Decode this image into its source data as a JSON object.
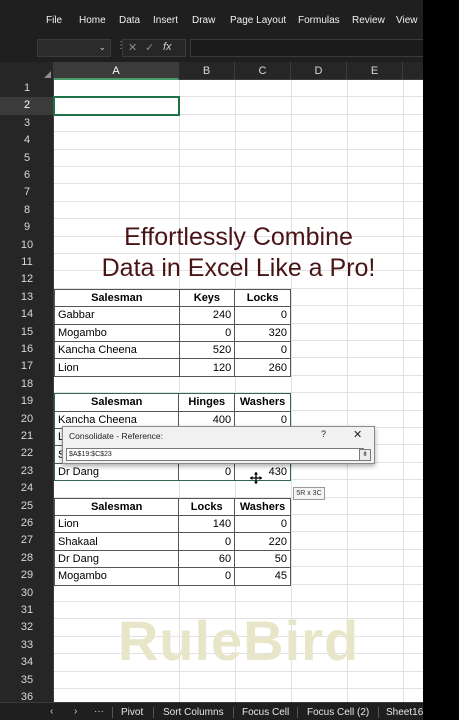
{
  "ribbon": {
    "tabs": [
      "File",
      "Home",
      "Data",
      "Insert",
      "Draw",
      "Page Layout",
      "Formulas",
      "Review",
      "View"
    ]
  },
  "formula_bar": {
    "name_box": "",
    "fx_label": "fx",
    "formula": ""
  },
  "columns": [
    "A",
    "B",
    "C",
    "D",
    "E"
  ],
  "rows": [
    "1",
    "2",
    "3",
    "4",
    "5",
    "6",
    "7",
    "8",
    "9",
    "10",
    "11",
    "12",
    "13",
    "14",
    "15",
    "16",
    "17",
    "18",
    "19",
    "20",
    "21",
    "22",
    "23",
    "24",
    "25",
    "26",
    "27",
    "28",
    "29",
    "30",
    "31",
    "32",
    "33",
    "34",
    "35",
    "36"
  ],
  "headline": {
    "line1": "Effortlessly Combine",
    "line2": "Data in Excel Like a Pro!"
  },
  "table1": {
    "headers": [
      "Salesman",
      "Keys",
      "Locks"
    ],
    "rows": [
      [
        "Gabbar",
        "240",
        "0"
      ],
      [
        "Mogambo",
        "0",
        "320"
      ],
      [
        "Kancha Cheena",
        "520",
        "0"
      ],
      [
        "Lion",
        "120",
        "260"
      ]
    ]
  },
  "table2": {
    "headers": [
      "Salesman",
      "Hinges",
      "Washers"
    ],
    "rows": [
      [
        "Kancha Cheena",
        "400",
        "0"
      ],
      [
        "L",
        "",
        ""
      ],
      [
        "S",
        "",
        ""
      ],
      [
        "Dr Dang",
        "0",
        "430"
      ]
    ]
  },
  "table3": {
    "headers": [
      "Salesman",
      "Locks",
      "Washers"
    ],
    "rows": [
      [
        "Lion",
        "140",
        "0"
      ],
      [
        "Shakaal",
        "0",
        "220"
      ],
      [
        "Dr Dang",
        "60",
        "50"
      ],
      [
        "Mogambo",
        "0",
        "45"
      ]
    ]
  },
  "dialog": {
    "title": "Consolidate - Reference:",
    "help": "?",
    "close": "✕",
    "reference": "$A$19:$C$23"
  },
  "size_tip": "5R x 3C",
  "watermark": "RuleBird",
  "sheet_tabs": {
    "nav_prev": "‹",
    "nav_next": "›",
    "more": "···",
    "tabs": [
      "Pivot",
      "Sort Columns",
      "Focus Cell",
      "Focus Cell (2)",
      "Sheet16"
    ]
  },
  "colors": {
    "selection": "#1e7145",
    "headline": "#4a1414",
    "watermark": "#e8e6c8"
  }
}
